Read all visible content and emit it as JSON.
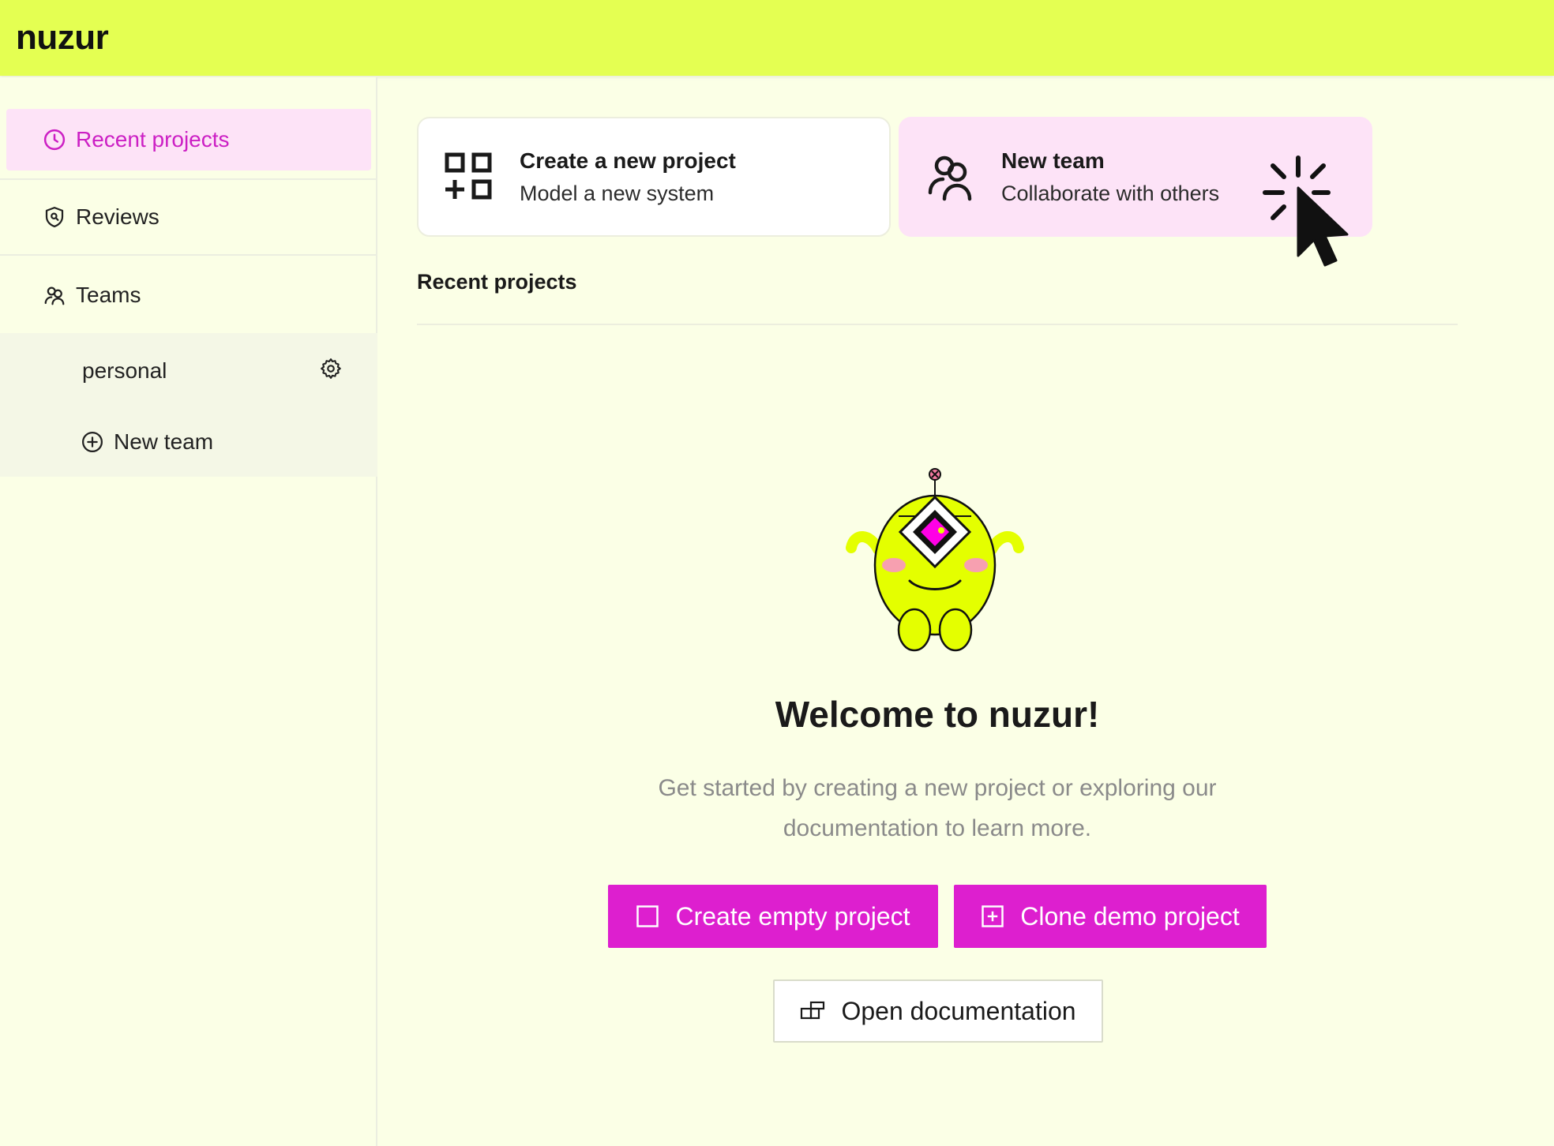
{
  "app": {
    "logo": "nuzur"
  },
  "sidebar": {
    "recent_projects": "Recent projects",
    "reviews": "Reviews",
    "teams": "Teams",
    "team_items": [
      {
        "label": "personal",
        "icon": "gear-icon"
      }
    ],
    "new_team": "New team"
  },
  "cards": {
    "create": {
      "title": "Create a new project",
      "subtitle": "Model a new system",
      "icon": "grid-plus-icon"
    },
    "team": {
      "title": "New team",
      "subtitle": "Collaborate with others",
      "icon": "users-icon"
    }
  },
  "main": {
    "section_title": "Recent projects",
    "welcome_title": "Welcome to nuzur!",
    "welcome_text": "Get started by creating a new project or exploring our documentation to learn more.",
    "buttons": {
      "create_empty": "Create empty project",
      "clone_demo": "Clone demo project",
      "open_docs": "Open documentation"
    }
  },
  "colors": {
    "topbar": "#e4ff52",
    "accent": "#dd1fcf",
    "active_nav_bg": "#fde3f7",
    "background": "#fbffe6"
  }
}
